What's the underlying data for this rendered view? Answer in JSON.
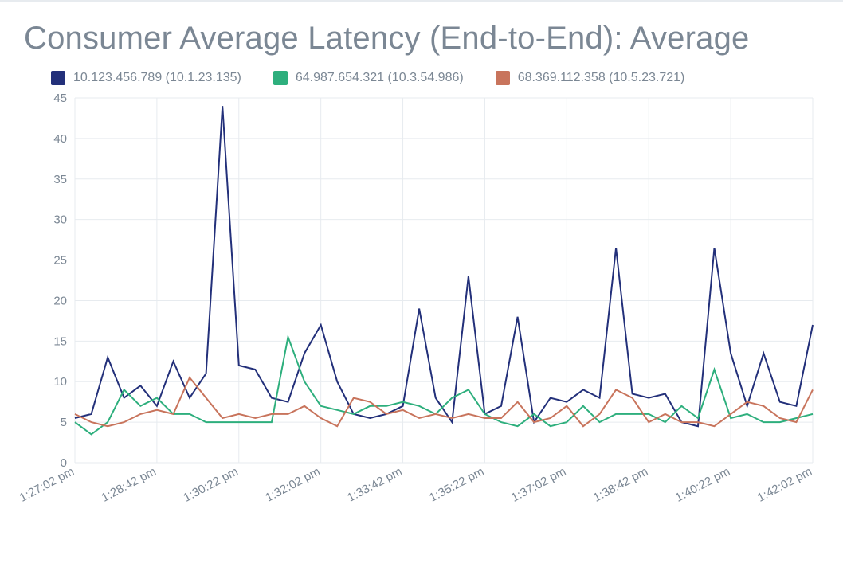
{
  "title": "Consumer Average Latency (End-to-End): Average",
  "legend": {
    "items": [
      {
        "label": "10.123.456.789 (10.1.23.135)",
        "color": "#23307a"
      },
      {
        "label": "64.987.654.321 (10.3.54.986)",
        "color": "#2eaf7d"
      },
      {
        "label": "68.369.112.358 (10.5.23.721)",
        "color": "#c8745c"
      }
    ]
  },
  "chart_data": {
    "type": "line",
    "xlabel": "",
    "ylabel": "",
    "title": "Consumer Average Latency (End-to-End): Average",
    "ylim": [
      0,
      45
    ],
    "y_ticks": [
      0,
      5,
      10,
      15,
      20,
      25,
      30,
      35,
      40,
      45
    ],
    "x_tick_labels": [
      "1:27:02 pm",
      "1:28:42 pm",
      "1:30:22 pm",
      "1:32:02 pm",
      "1:33:42 pm",
      "1:35:22 pm",
      "1:37:02 pm",
      "1:38:42 pm",
      "1:40:22 pm",
      "1:42:02 pm"
    ],
    "x_tick_indices": [
      0,
      5,
      10,
      15,
      20,
      25,
      30,
      35,
      40,
      45
    ],
    "n_points": 46,
    "series": [
      {
        "name": "10.123.456.789 (10.1.23.135)",
        "color": "#23307a",
        "values": [
          5.5,
          6,
          13,
          8,
          9.5,
          7,
          12.5,
          8,
          11,
          44,
          12,
          11.5,
          8,
          7.5,
          13.5,
          17,
          10,
          6,
          5.5,
          6,
          7,
          19,
          8,
          5,
          23,
          6,
          7,
          18,
          5,
          8,
          7.5,
          9,
          8,
          26.5,
          8.5,
          8,
          8.5,
          5,
          4.5,
          26.5,
          13.5,
          7,
          13.5,
          7.5,
          7,
          17
        ]
      },
      {
        "name": "64.987.654.321 (10.3.54.986)",
        "color": "#2eaf7d",
        "values": [
          5,
          3.5,
          5,
          9,
          7,
          8,
          6,
          6,
          5,
          5,
          5,
          5,
          5,
          15.5,
          10,
          7,
          6.5,
          6,
          7,
          7,
          7.5,
          7,
          6,
          8,
          9,
          6,
          5,
          4.5,
          6,
          4.5,
          5,
          7,
          5,
          6,
          6,
          6,
          5,
          7,
          5.5,
          11.5,
          5.5,
          6,
          5,
          5,
          5.5,
          6
        ]
      },
      {
        "name": "68.369.112.358 (10.5.23.721)",
        "color": "#c8745c",
        "values": [
          6,
          5,
          4.5,
          5,
          6,
          6.5,
          6,
          10.5,
          8,
          5.5,
          6,
          5.5,
          6,
          6,
          7,
          5.5,
          4.5,
          8,
          7.5,
          6,
          6.5,
          5.5,
          6,
          5.5,
          6,
          5.5,
          5.5,
          7.5,
          5,
          5.5,
          7,
          4.5,
          6,
          9,
          8,
          5,
          6,
          5,
          5,
          4.5,
          6,
          7.5,
          7,
          5.5,
          5,
          9
        ]
      }
    ]
  }
}
